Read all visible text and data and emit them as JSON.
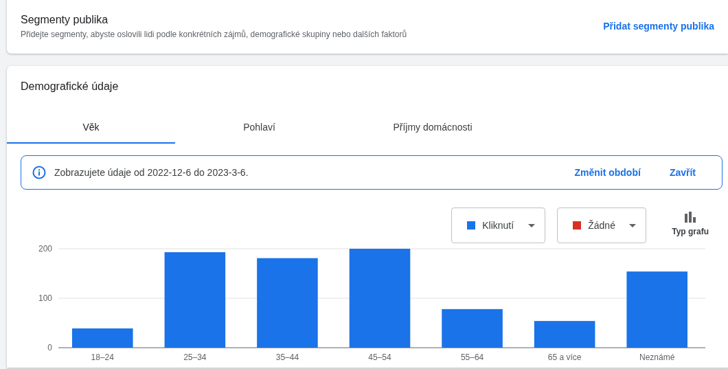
{
  "segments_card": {
    "title": "Segmenty publika",
    "description": "Přidejte segmenty, abyste oslovili lidi podle konkrétních zájmů, demografické skupiny nebo dalších faktorů",
    "link": "Přidat segmenty publika"
  },
  "demographics": {
    "title": "Demografické údaje",
    "tabs": [
      {
        "label": "Věk",
        "selected": true
      },
      {
        "label": "Pohlaví",
        "selected": false
      },
      {
        "label": "Příjmy domácnosti",
        "selected": false
      }
    ],
    "notice": {
      "text": "Zobrazujete údaje od 2022-12-6 do 2023-3-6.",
      "actions": [
        "Změnit období",
        "Zavřít"
      ]
    },
    "metric_selectors": [
      {
        "label": "Kliknutí",
        "color": "#1a73e8"
      },
      {
        "label": "Žádné",
        "color": "#d93025"
      }
    ],
    "chart_type_button": "Typ grafu",
    "chart_data": {
      "type": "bar",
      "categories": [
        "18–24",
        "25–34",
        "35–44",
        "45–54",
        "55–64",
        "65 a více",
        "Neznámé"
      ],
      "series": [
        {
          "color": "#1a73e8",
          "values": [
            39,
            193,
            181,
            200,
            78,
            54,
            154
          ]
        }
      ],
      "ylim": [
        0,
        200
      ],
      "yticks": [
        0,
        100,
        200
      ]
    }
  }
}
